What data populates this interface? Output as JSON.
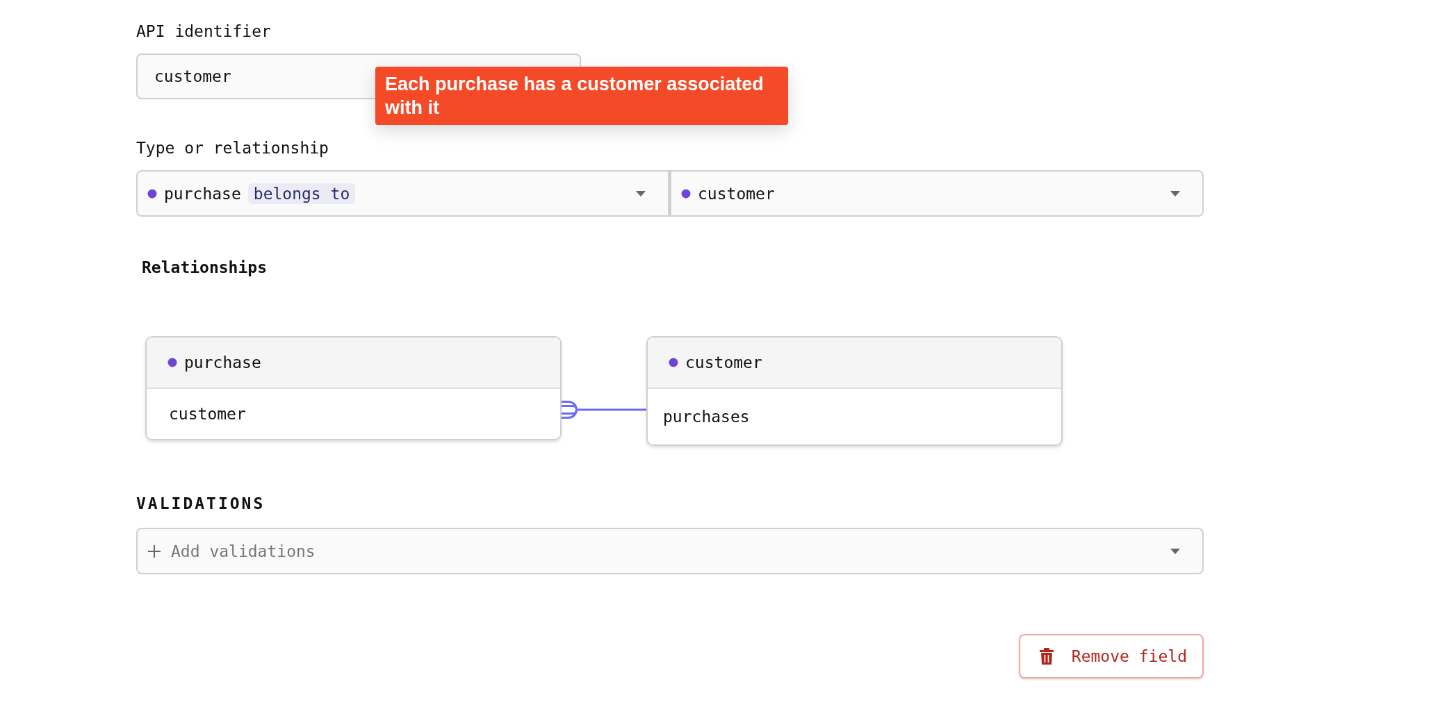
{
  "api_identifier": {
    "label": "API identifier",
    "value": "customer"
  },
  "tooltip": {
    "text": "Each purchase has a customer associated with it"
  },
  "type_or_relationship": {
    "label": "Type or relationship",
    "source": {
      "model": "purchase",
      "relation": "belongs to"
    },
    "target": {
      "model": "customer"
    }
  },
  "relationships": {
    "title": "Relationships",
    "source": {
      "model": "purchase",
      "field": "customer"
    },
    "target": {
      "model": "customer",
      "field": "purchases"
    }
  },
  "validations": {
    "title": "VALIDATIONS",
    "placeholder": "Add validations"
  },
  "remove_button": {
    "label": "Remove field"
  }
}
